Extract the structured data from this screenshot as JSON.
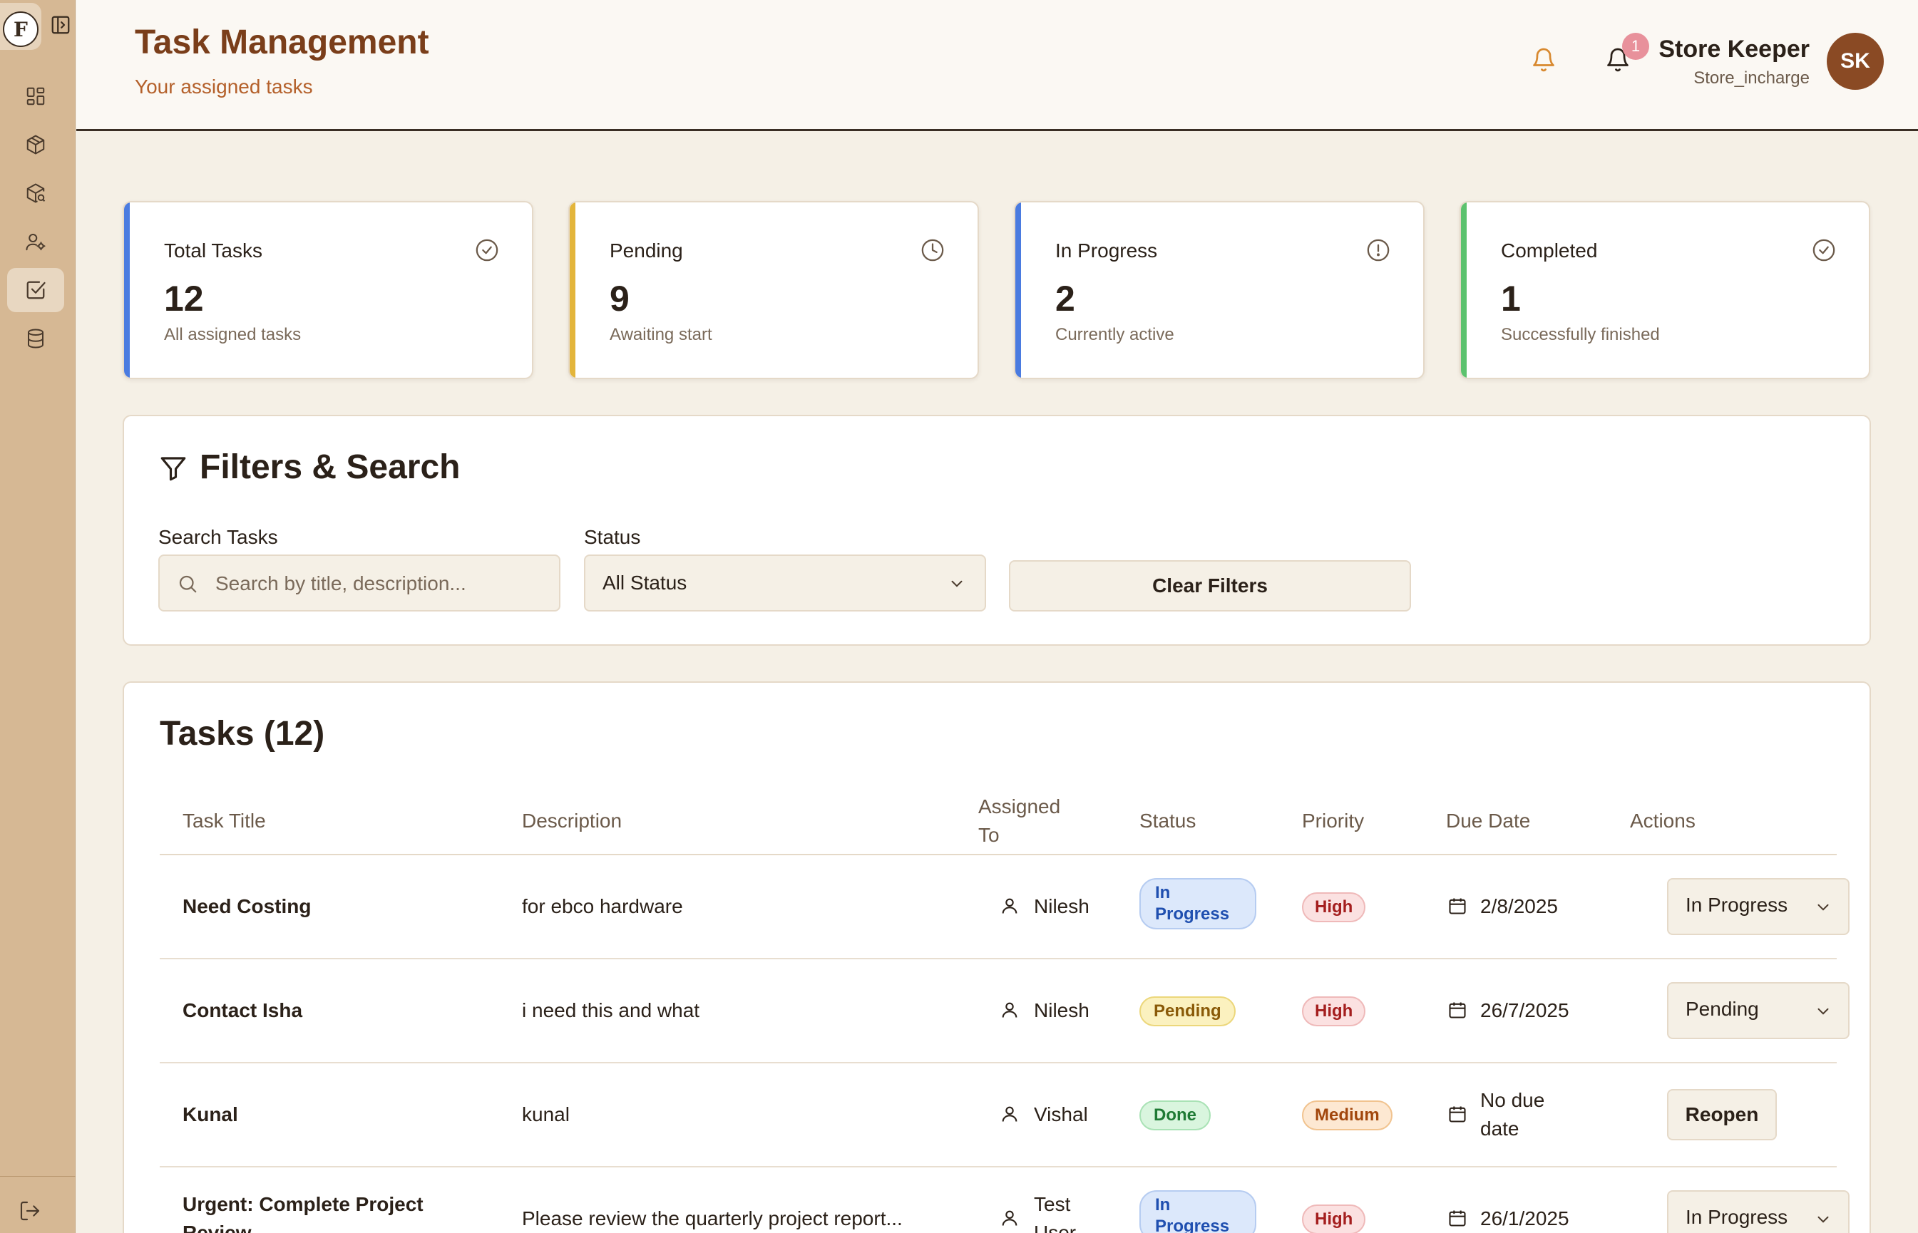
{
  "app": {
    "logo_letter": "F"
  },
  "header": {
    "title": "Task Management",
    "subtitle": "Your assigned tasks",
    "notification_count": "1",
    "user_name": "Store Keeper",
    "user_role": "Store_incharge",
    "avatar_initials": "SK"
  },
  "sidebar": {
    "items": [
      {
        "icon": "dashboard-grid-icon"
      },
      {
        "icon": "package-icon"
      },
      {
        "icon": "package-search-icon"
      },
      {
        "icon": "user-settings-icon"
      },
      {
        "icon": "task-checkbox-icon",
        "active": true
      },
      {
        "icon": "database-icon"
      }
    ],
    "footer_icon": "logout-icon"
  },
  "stats": [
    {
      "label": "Total Tasks",
      "value": "12",
      "desc": "All assigned tasks",
      "icon": "check-circle-icon",
      "accent": "#4a7be0"
    },
    {
      "label": "Pending",
      "value": "9",
      "desc": "Awaiting start",
      "icon": "clock-icon",
      "accent": "#e3b53b"
    },
    {
      "label": "In Progress",
      "value": "2",
      "desc": "Currently active",
      "icon": "alert-circle-icon",
      "accent": "#4a7be0"
    },
    {
      "label": "Completed",
      "value": "1",
      "desc": "Successfully finished",
      "icon": "check-circle-icon",
      "accent": "#5cc26e"
    }
  ],
  "filters": {
    "title": "Filters & Search",
    "search_label": "Search Tasks",
    "search_placeholder": "Search by title, description...",
    "search_value": "",
    "status_label": "Status",
    "status_value": "All Status",
    "clear_label": "Clear Filters"
  },
  "tasks": {
    "title": "Tasks (12)",
    "columns": [
      "Task Title",
      "Description",
      "Assigned To",
      "Status",
      "Priority",
      "Due Date",
      "Actions"
    ],
    "rows": [
      {
        "title": "Need Costing",
        "desc": "for ebco hardware",
        "assignee": "Nilesh",
        "status": "In Progress",
        "priority": "High",
        "due": "2/8/2025",
        "action": "In Progress"
      },
      {
        "title": "Contact Isha",
        "desc": "i need this and what",
        "assignee": "Nilesh",
        "status": "Pending",
        "priority": "High",
        "due": "26/7/2025",
        "action": "Pending"
      },
      {
        "title": "Kunal",
        "desc": "kunal",
        "assignee": "Vishal",
        "status": "Done",
        "priority": "Medium",
        "due": "No due date",
        "action": "Reopen"
      },
      {
        "title": "Urgent: Complete Project Review",
        "desc": "Please review the quarterly project report...",
        "assignee": "Test User",
        "status": "In Progress",
        "priority": "High",
        "due": "26/1/2025",
        "action": "In Progress"
      }
    ]
  },
  "colors": {
    "brand_dark": "#7a3e1a",
    "brand_light": "#b4602a",
    "sidebar_bg": "#d6b894",
    "page_bg": "#f5f0e6"
  }
}
